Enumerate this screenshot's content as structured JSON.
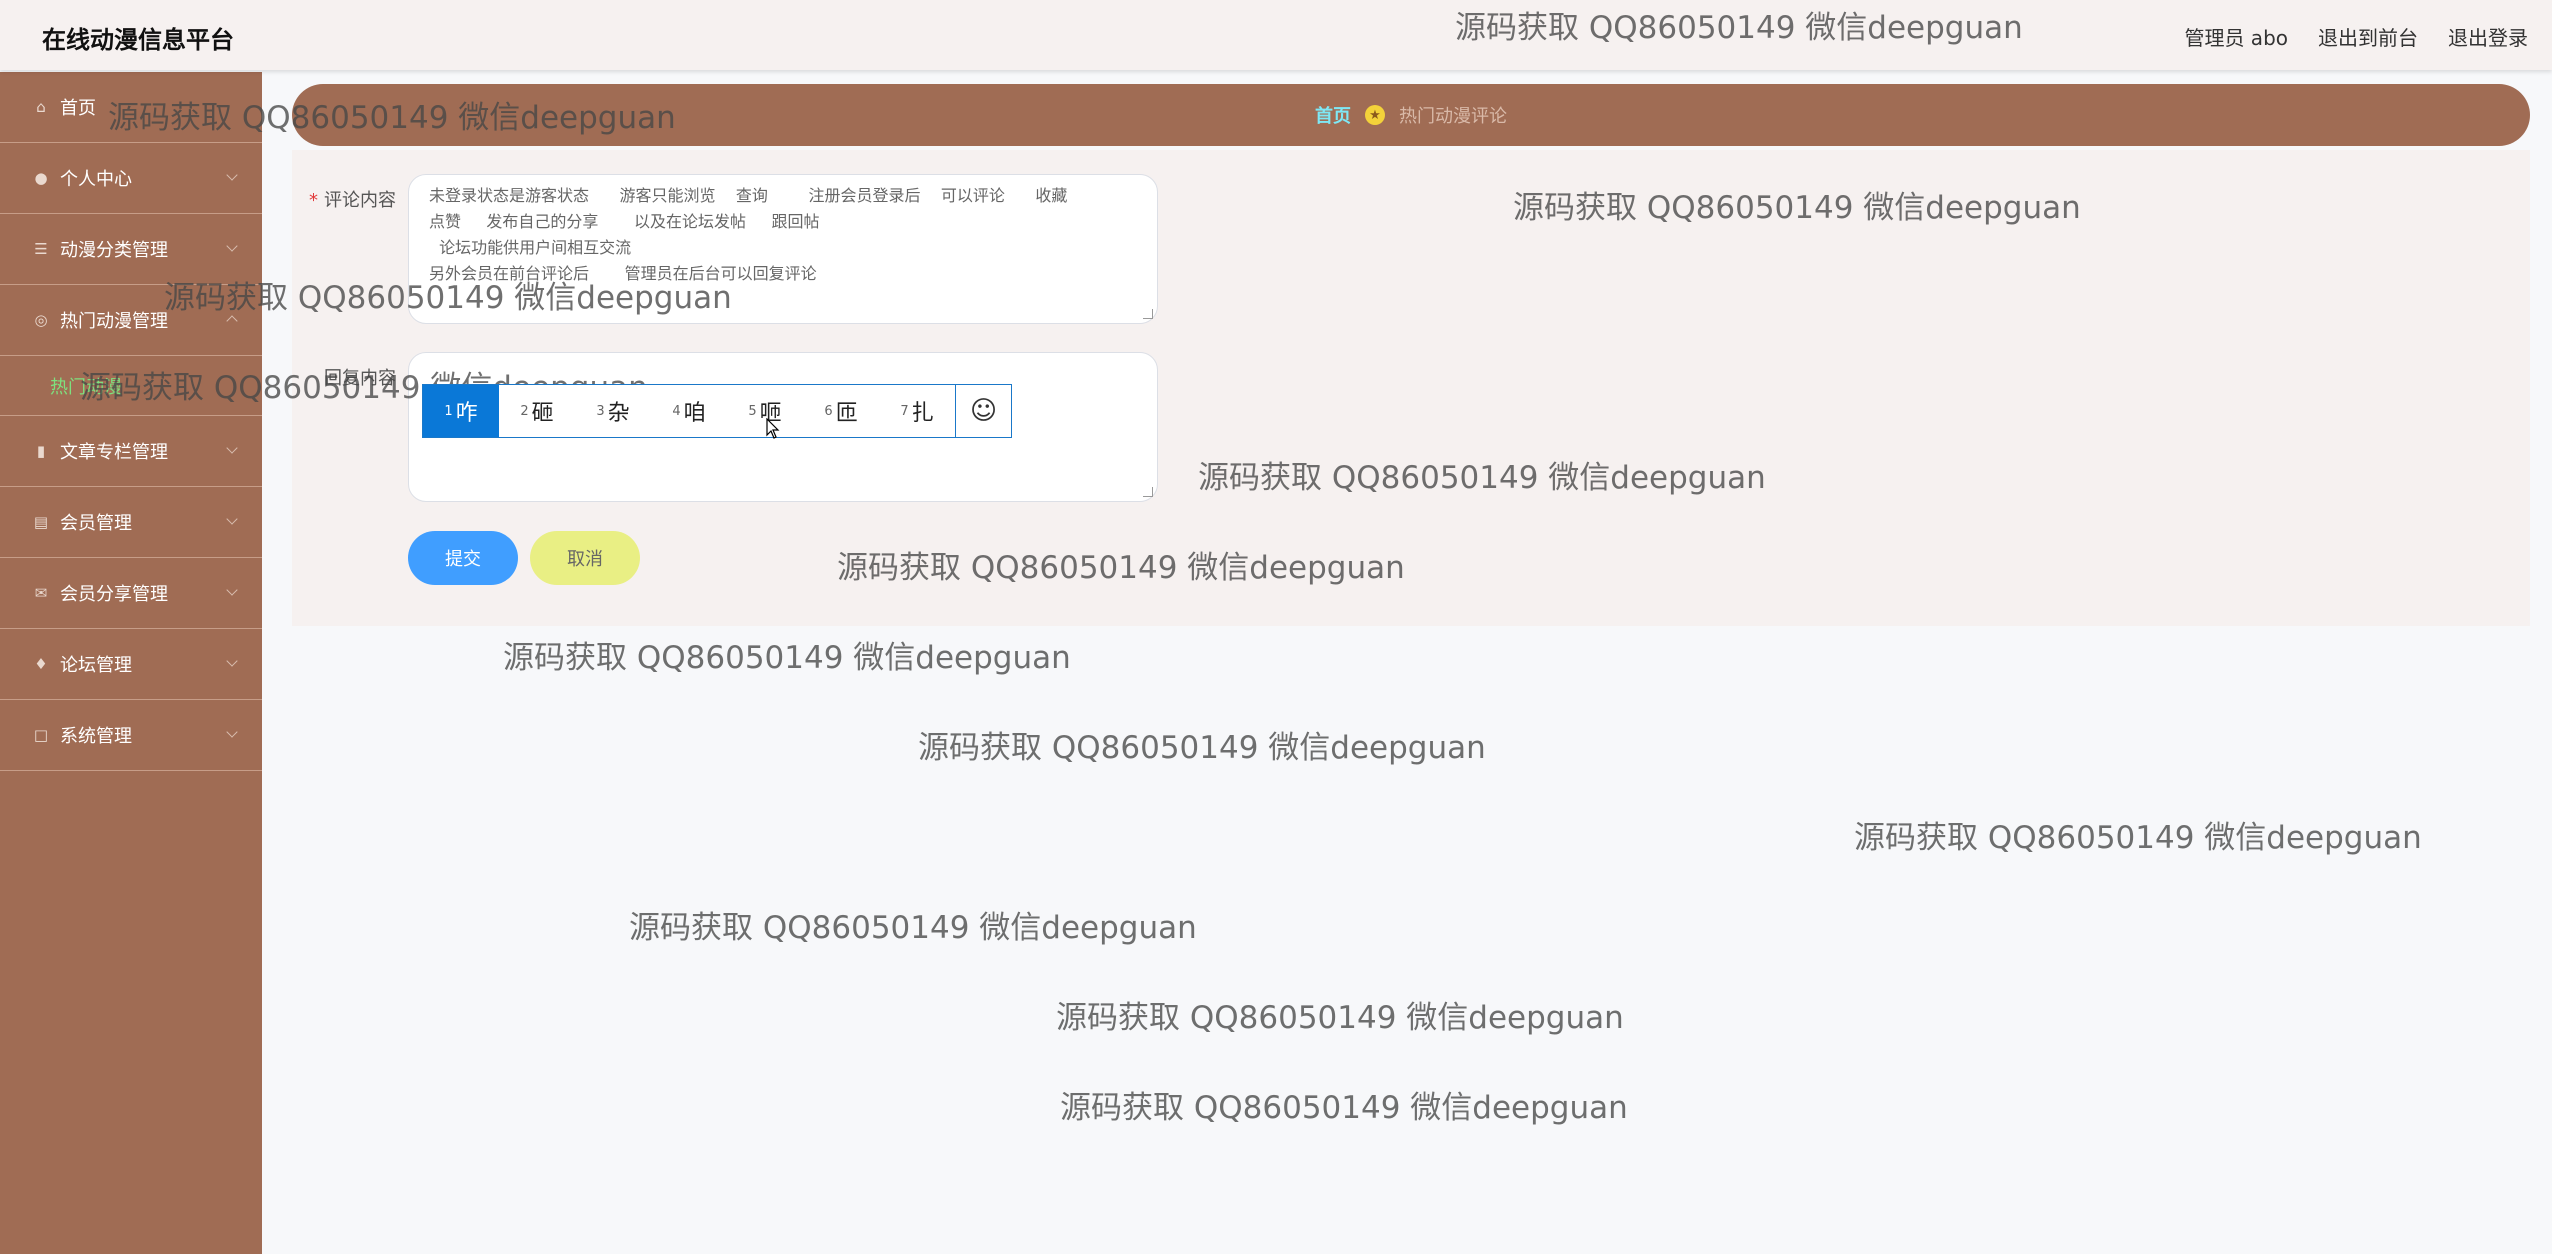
{
  "header": {
    "app_title": "在线动漫信息平台",
    "admin_label": "管理员 abo",
    "front_link": "退出到前台",
    "logout_link": "退出登录"
  },
  "sidebar": {
    "items": [
      {
        "label": "首页",
        "icon": "home-icon"
      },
      {
        "label": "个人中心",
        "icon": "user-icon"
      },
      {
        "label": "动漫分类管理",
        "icon": "list-icon"
      },
      {
        "label": "热门动漫管理",
        "icon": "circle-icon"
      },
      {
        "label": "文章专栏管理",
        "icon": "chart-icon"
      },
      {
        "label": "会员管理",
        "icon": "clipboard-icon"
      },
      {
        "label": "会员分享管理",
        "icon": "mail-icon"
      },
      {
        "label": "论坛管理",
        "icon": "pin-icon"
      },
      {
        "label": "系统管理",
        "icon": "square-icon"
      }
    ],
    "submenu": {
      "label": "热门动漫"
    }
  },
  "breadcrumb": {
    "home": "首页",
    "current": "热门动漫评论"
  },
  "form": {
    "comment_label": "评论内容",
    "comment_lines": [
      "未登录状态是游客状态      游客只能浏览    查询        注册会员登录后    可以评论      收藏",
      "点赞     发布自己的分享       以及在论坛发帖     跟回帖",
      "  论坛功能供用户间相互交流",
      "另外会员在前台评论后       管理员在后台可以回复评论"
    ],
    "reply_label": "回复内容",
    "submit": "提交",
    "cancel": "取消"
  },
  "ime": {
    "candidates": [
      {
        "num": "1",
        "char": "咋"
      },
      {
        "num": "2",
        "char": "砸"
      },
      {
        "num": "3",
        "char": "杂"
      },
      {
        "num": "4",
        "char": "咱"
      },
      {
        "num": "5",
        "char": "咂"
      },
      {
        "num": "6",
        "char": "匝"
      },
      {
        "num": "7",
        "char": "扎"
      }
    ],
    "emoji": "☺"
  },
  "watermark": "源码获取 QQ86050149 微信deepguan",
  "colors": {
    "sidebar": "#a06c54",
    "header": "#f6f1f0",
    "submit": "#409eff",
    "cancel": "#e9ef84",
    "active_submenu": "#7ee07e",
    "breadcrumb_home": "#7ee8f5"
  }
}
